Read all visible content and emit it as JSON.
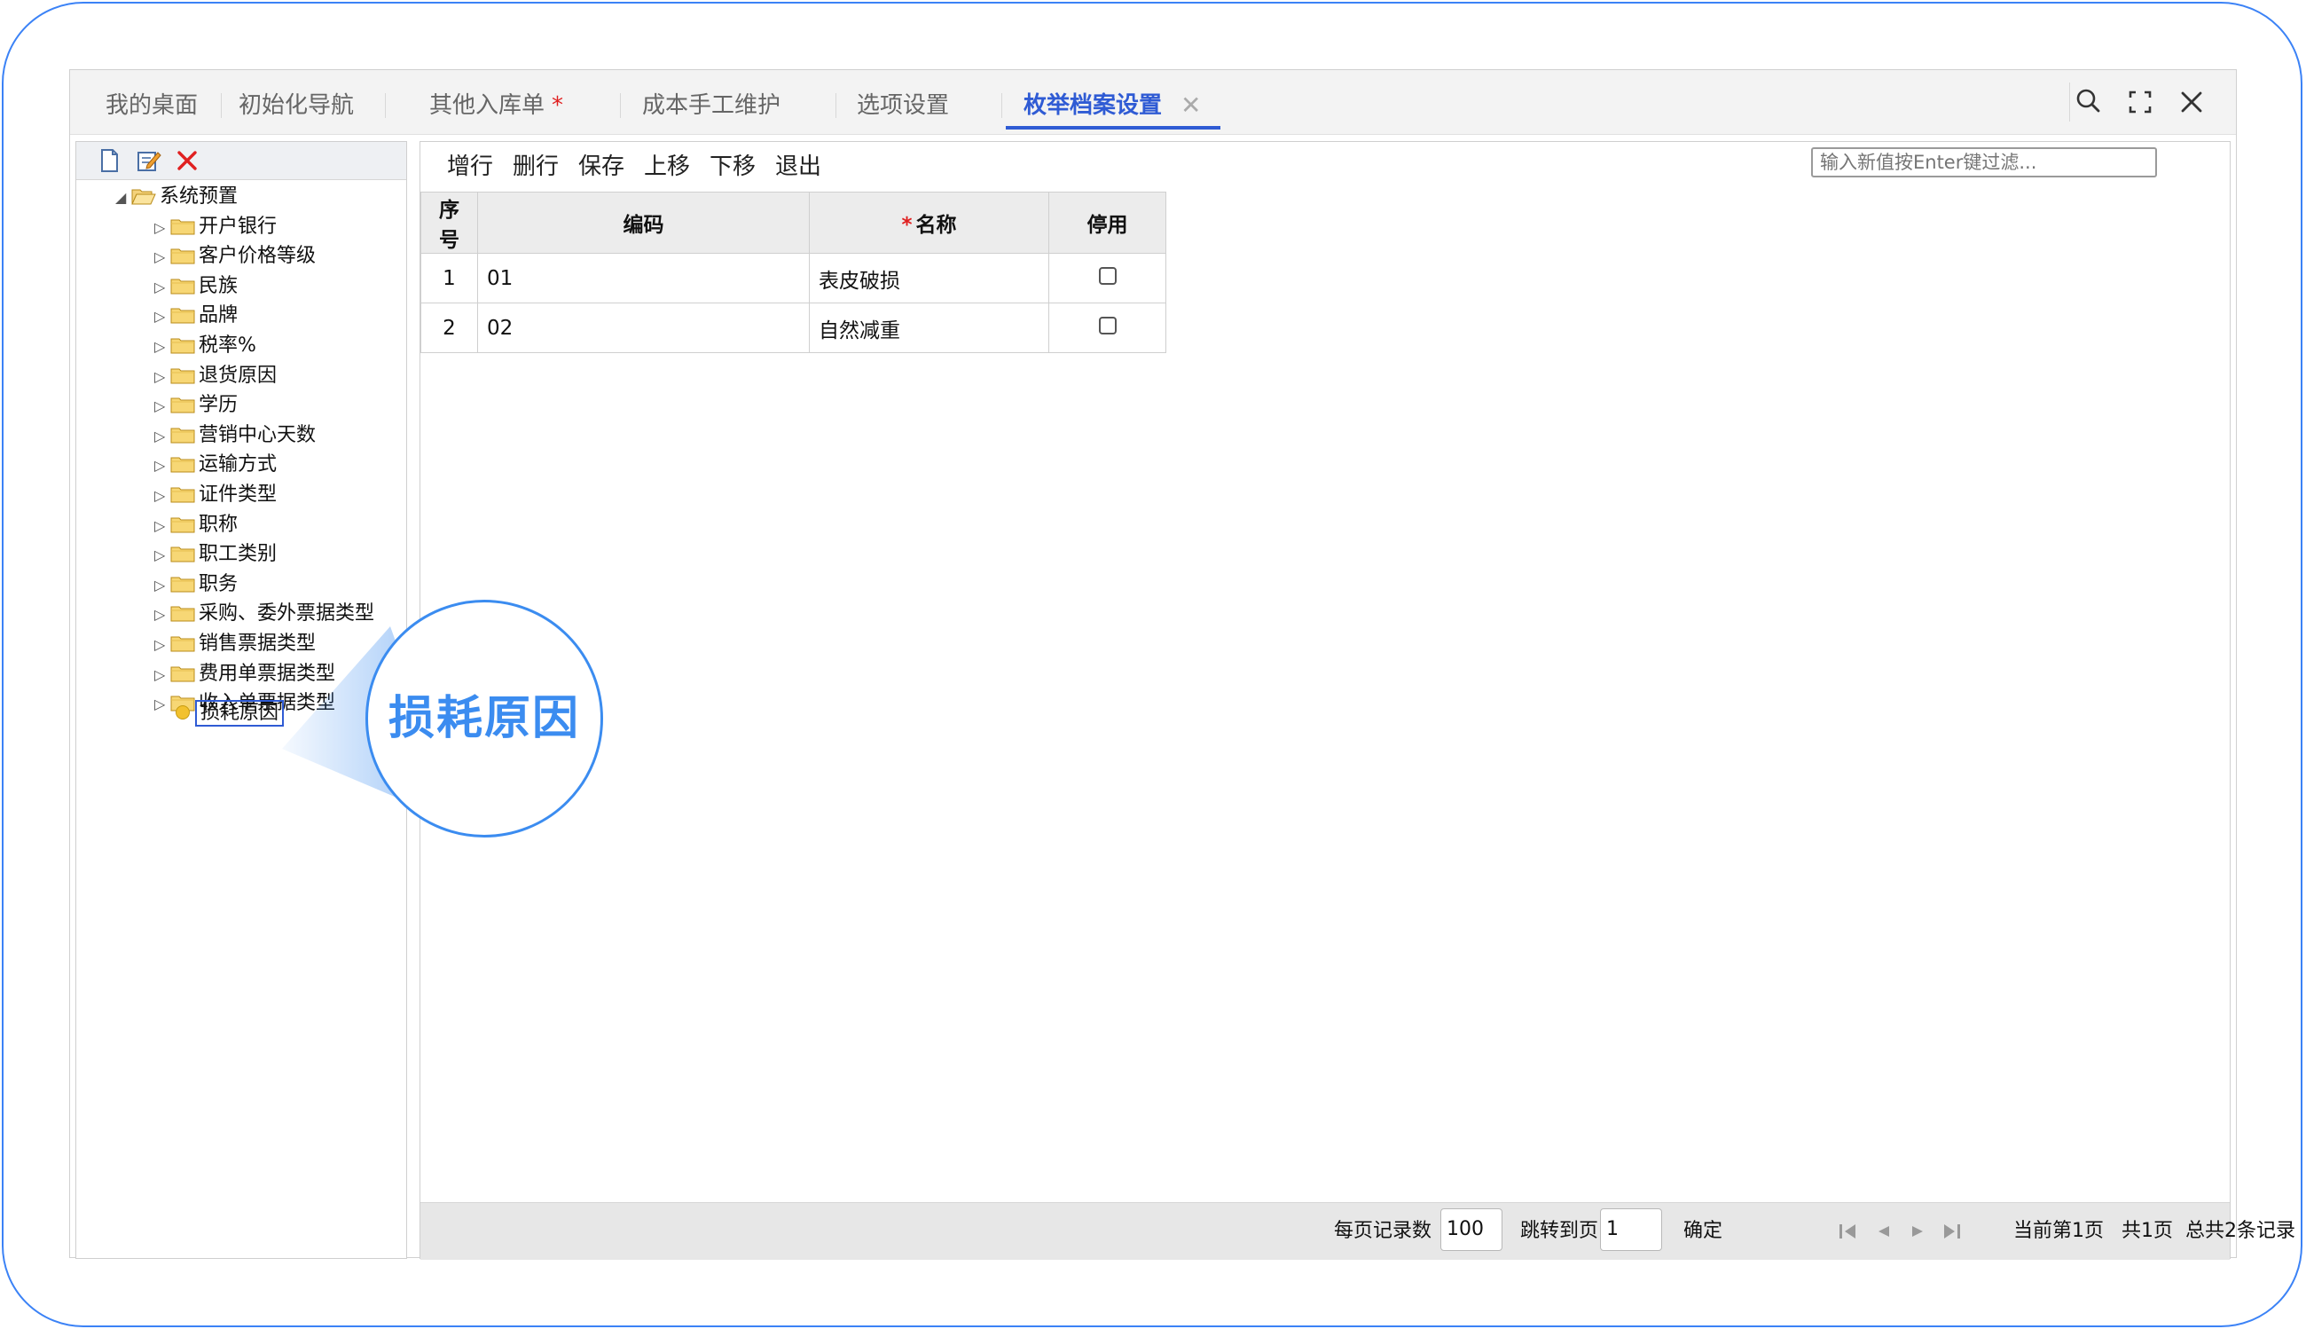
{
  "tabs": [
    {
      "label": "我的桌面",
      "required": false,
      "active": false
    },
    {
      "label": "初始化导航",
      "required": false,
      "active": false
    },
    {
      "label": "其他入库单",
      "required": true,
      "active": false
    },
    {
      "label": "成本手工维护",
      "required": false,
      "active": false
    },
    {
      "label": "选项设置",
      "required": false,
      "active": false
    },
    {
      "label": "枚举档案设置",
      "required": false,
      "active": true
    }
  ],
  "tab_required_mark": "*",
  "tab_close": "✕",
  "window_icons": [
    "search-icon",
    "fullscreen-icon",
    "close-icon"
  ],
  "left_toolbar_icons": [
    "new-doc-icon",
    "edit-icon",
    "delete-icon"
  ],
  "tree": {
    "root": "系统预置",
    "children": [
      "开户银行",
      "客户价格等级",
      "民族",
      "品牌",
      "税率%",
      "退货原因",
      "学历",
      "营销中心天数",
      "运输方式",
      "证件类型",
      "职称",
      "职工类别",
      "职务",
      "采购、委外票据类型",
      "销售票据类型",
      "费用单票据类型",
      "收入单票据类型"
    ],
    "selected": "损耗原因"
  },
  "toolbar": {
    "add_row": "增行",
    "delete_row": "删行",
    "save": "保存",
    "move_up": "上移",
    "move_down": "下移",
    "exit": "退出"
  },
  "filter_placeholder": "输入新值按Enter键过滤...",
  "grid": {
    "headers": {
      "seq": "序号",
      "code": "编码",
      "name_required": "*",
      "name": "名称",
      "disabled": "停用"
    },
    "rows": [
      {
        "seq": "1",
        "code": "01",
        "name": "表皮破损",
        "disabled": false
      },
      {
        "seq": "2",
        "code": "02",
        "name": "自然减重",
        "disabled": false
      }
    ]
  },
  "footer": {
    "per_page_label": "每页记录数",
    "per_page": "100",
    "jump_label": "跳转到页",
    "jump_page": "1",
    "confirm": "确定",
    "current_page": "当前第1页",
    "total_pages": "共1页",
    "total_records": "总共2条记录"
  },
  "callout_text": "损耗原因",
  "colors": {
    "accent": "#2f5bd4",
    "callout": "#3b8cf0",
    "required": "#e02020",
    "frame": "#3b82f6"
  }
}
